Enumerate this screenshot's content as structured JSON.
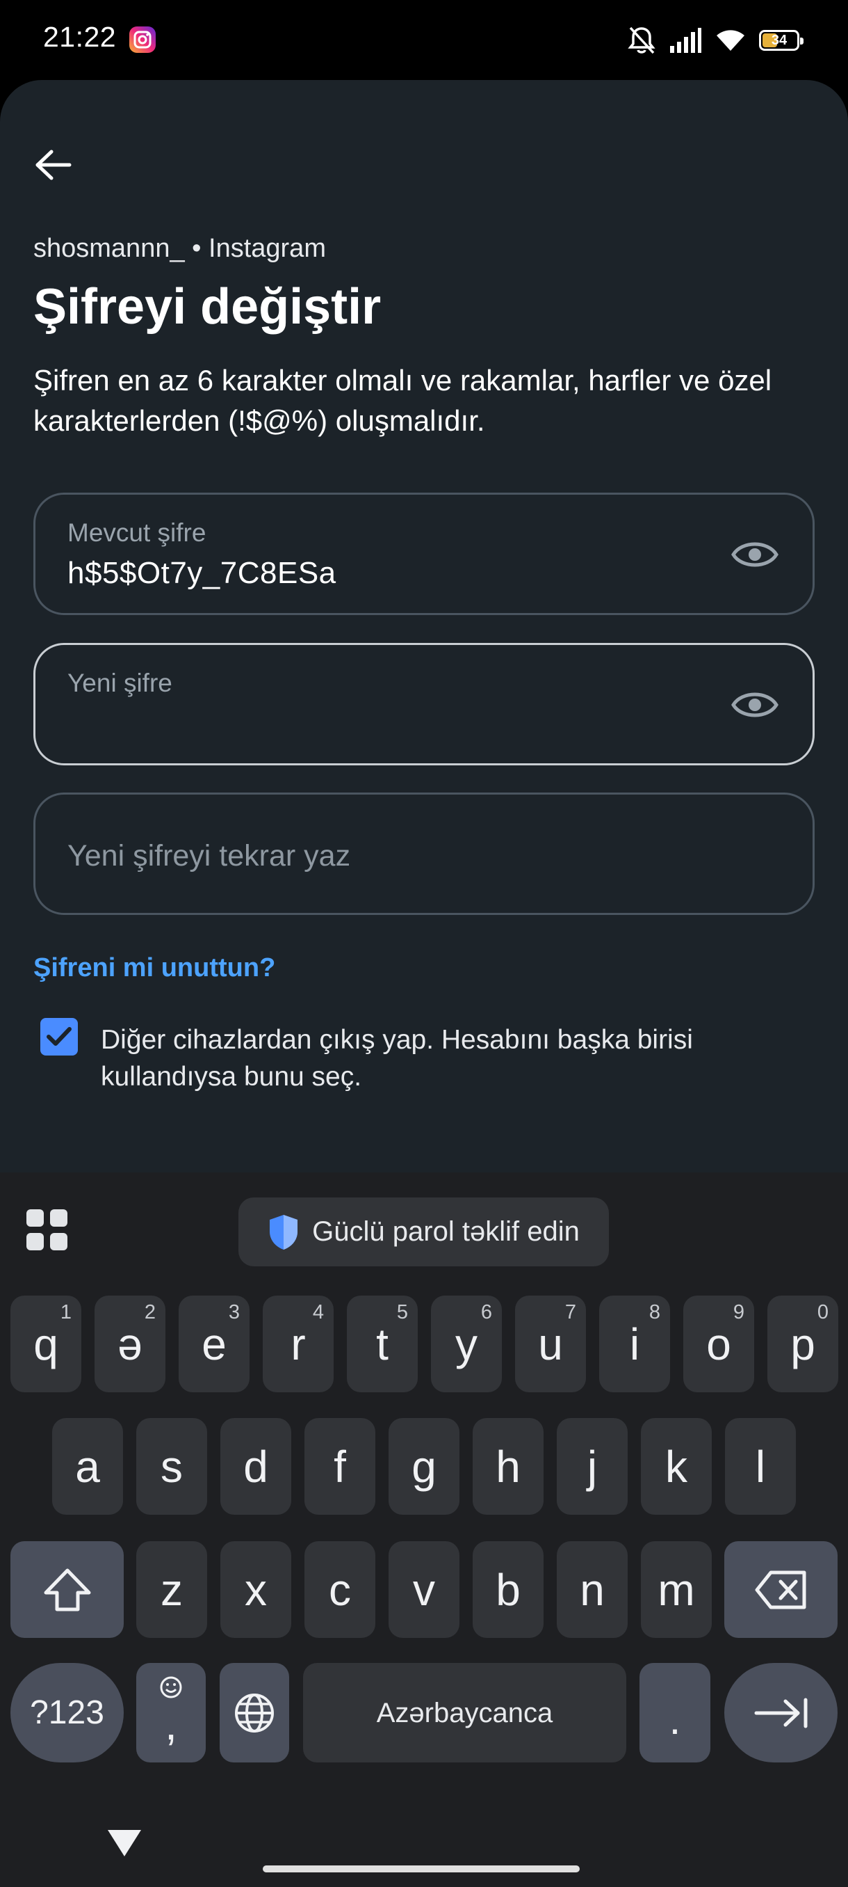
{
  "status_bar": {
    "time": "21:22",
    "battery_level": "34",
    "icons": [
      "instagram-icon",
      "bell-muted-icon",
      "signal-icon",
      "wifi-icon",
      "battery-icon"
    ]
  },
  "header": {
    "account": "shosmannn_ • Instagram",
    "title": "Şifreyi değiştir",
    "description": "Şifren en az 6 karakter olmalı ve rakamlar, harfler ve özel karakterlerden (!$@%) oluşmalıdır."
  },
  "form": {
    "current_password": {
      "label": "Mevcut şifre",
      "value": "h$5$Ot7y_7C8ESa"
    },
    "new_password": {
      "label": "Yeni şifre",
      "value": ""
    },
    "repeat_password": {
      "placeholder": "Yeni şifreyi tekrar yaz"
    },
    "forgot_link": "Şifreni mi unuttun?",
    "logout_other_devices": {
      "checked": true,
      "text": "Diğer cihazlardan çıkış yap. Hesabını başka birisi kullandıysa bunu seç."
    }
  },
  "keyboard": {
    "suggestion": "Güclü parol təklif edin",
    "row1": [
      {
        "k": "q",
        "h": "1"
      },
      {
        "k": "ə",
        "h": "2"
      },
      {
        "k": "e",
        "h": "3"
      },
      {
        "k": "r",
        "h": "4"
      },
      {
        "k": "t",
        "h": "5"
      },
      {
        "k": "y",
        "h": "6"
      },
      {
        "k": "u",
        "h": "7"
      },
      {
        "k": "i",
        "h": "8"
      },
      {
        "k": "o",
        "h": "9"
      },
      {
        "k": "p",
        "h": "0"
      }
    ],
    "row2": [
      "a",
      "s",
      "d",
      "f",
      "g",
      "h",
      "j",
      "k",
      "l"
    ],
    "row3": [
      "z",
      "x",
      "c",
      "v",
      "b",
      "n",
      "m"
    ],
    "symbols_label": "?123",
    "comma_label": ",",
    "space_label": "Azərbaycanca",
    "period_label": ".",
    "colors": {
      "key": "#323438",
      "alt_key": "#4a4f5c",
      "accent": "#4da3ff",
      "checkbox": "#4a8cff"
    }
  }
}
